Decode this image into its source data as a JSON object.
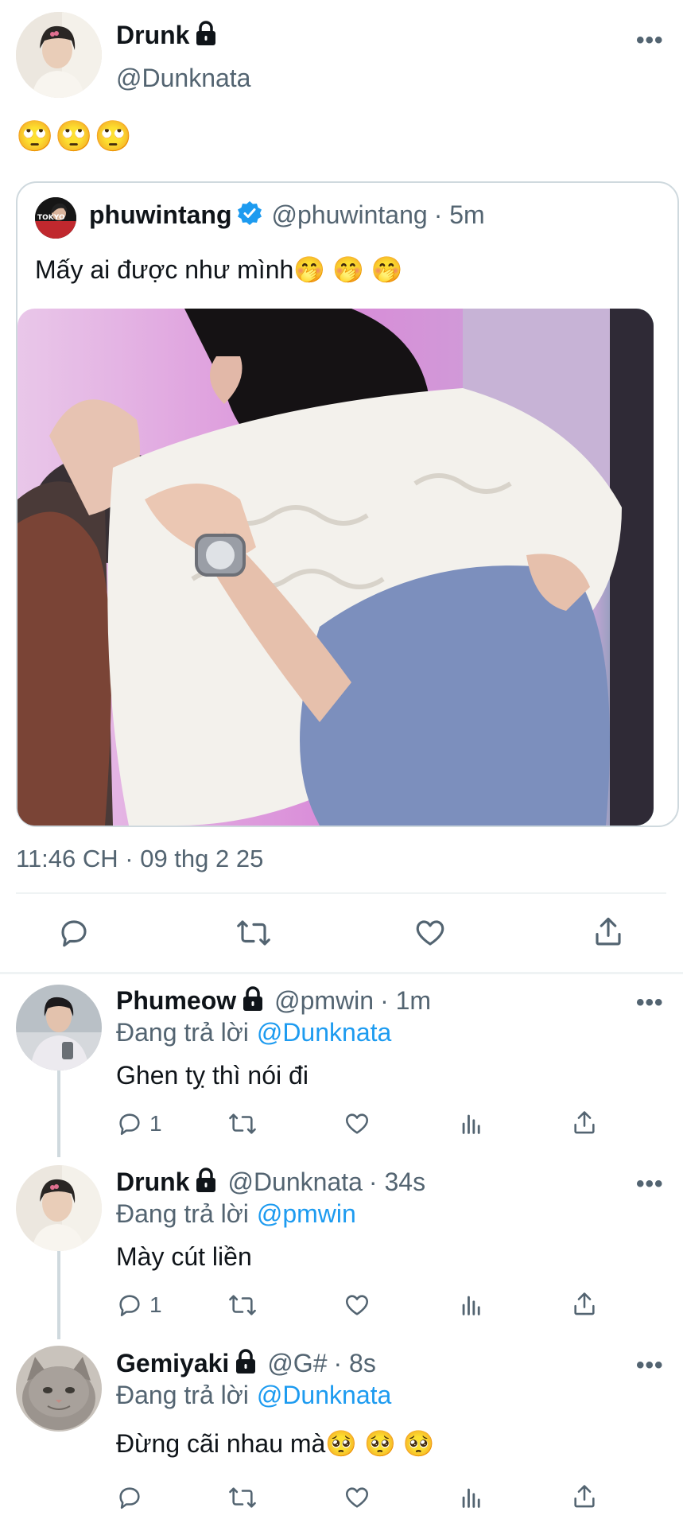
{
  "main_tweet": {
    "display_name": "Drunk",
    "handle": "@Dunknata",
    "more_label": "•••",
    "text": "🙄🙄🙄",
    "quoted": {
      "display_name": "phuwintang",
      "handle": "@phuwintang",
      "time": "· 5m",
      "text": "Mấy ai được như mình🤭 🤭 🤭",
      "avatar_text": "TOKYO"
    },
    "timestamp": "11:46 CH · 09 thg 2 25",
    "actions": [
      "reply-icon",
      "retweet-icon",
      "like-icon",
      "share-icon"
    ]
  },
  "replies": [
    {
      "display_name": "Phumeow",
      "handle": "@pmwin",
      "time": "· 1m",
      "replying_prefix": "Đang trả lời",
      "replying_to": "@Dunknata",
      "text": "Ghen tỵ thì nói đi",
      "reply_count": "1"
    },
    {
      "display_name": "Drunk",
      "handle": "@Dunknata",
      "time": "· 34s",
      "replying_prefix": "Đang trả lời",
      "replying_to": "@pmwin",
      "text": "Mày cút liền",
      "reply_count": "1"
    },
    {
      "display_name": "Gemiyaki",
      "handle": "@G#",
      "time": "· 8s",
      "replying_prefix": "Đang trả lời",
      "replying_to": "@Dunknata",
      "text": "Đừng cãi nhau mà🥺 🥺 🥺",
      "reply_count": ""
    }
  ],
  "colors": {
    "accent": "#1d9bf0",
    "muted": "#536471",
    "border": "#cfd9de"
  }
}
